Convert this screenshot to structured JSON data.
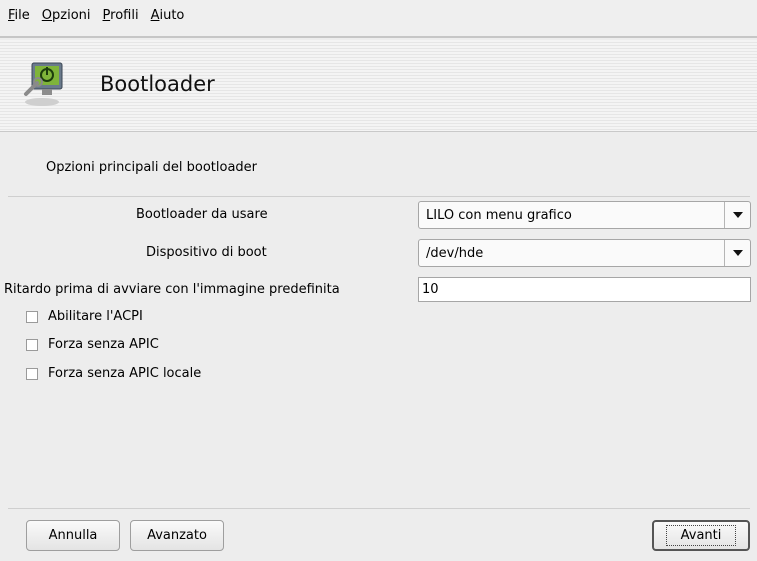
{
  "menubar": {
    "items": [
      {
        "accel": "F",
        "rest": "ile"
      },
      {
        "accel": "O",
        "rest": "pzioni"
      },
      {
        "accel": "P",
        "rest": "rofili"
      },
      {
        "accel": "A",
        "rest": "iuto"
      }
    ]
  },
  "header": {
    "title": "Bootloader",
    "icon": "bootloader-icon"
  },
  "main": {
    "section_title": "Opzioni principali del bootloader",
    "bootloader_label": "Bootloader da usare",
    "bootloader_value": "LILO con menu grafico",
    "boot_device_label": "Dispositivo di boot",
    "boot_device_value": "/dev/hde",
    "delay_label": "Ritardo prima di avviare con l'immagine predefinita",
    "delay_value": "10",
    "checkboxes": [
      {
        "label": "Abilitare l'ACPI",
        "checked": false
      },
      {
        "label": "Forza senza APIC",
        "checked": false
      },
      {
        "label": "Forza senza APIC locale",
        "checked": false
      }
    ]
  },
  "buttons": {
    "cancel": "Annulla",
    "advanced": "Avanzato",
    "next": "Avanti"
  },
  "colors": {
    "background": "#ededed",
    "header_stripe": "#e6e6e6"
  }
}
